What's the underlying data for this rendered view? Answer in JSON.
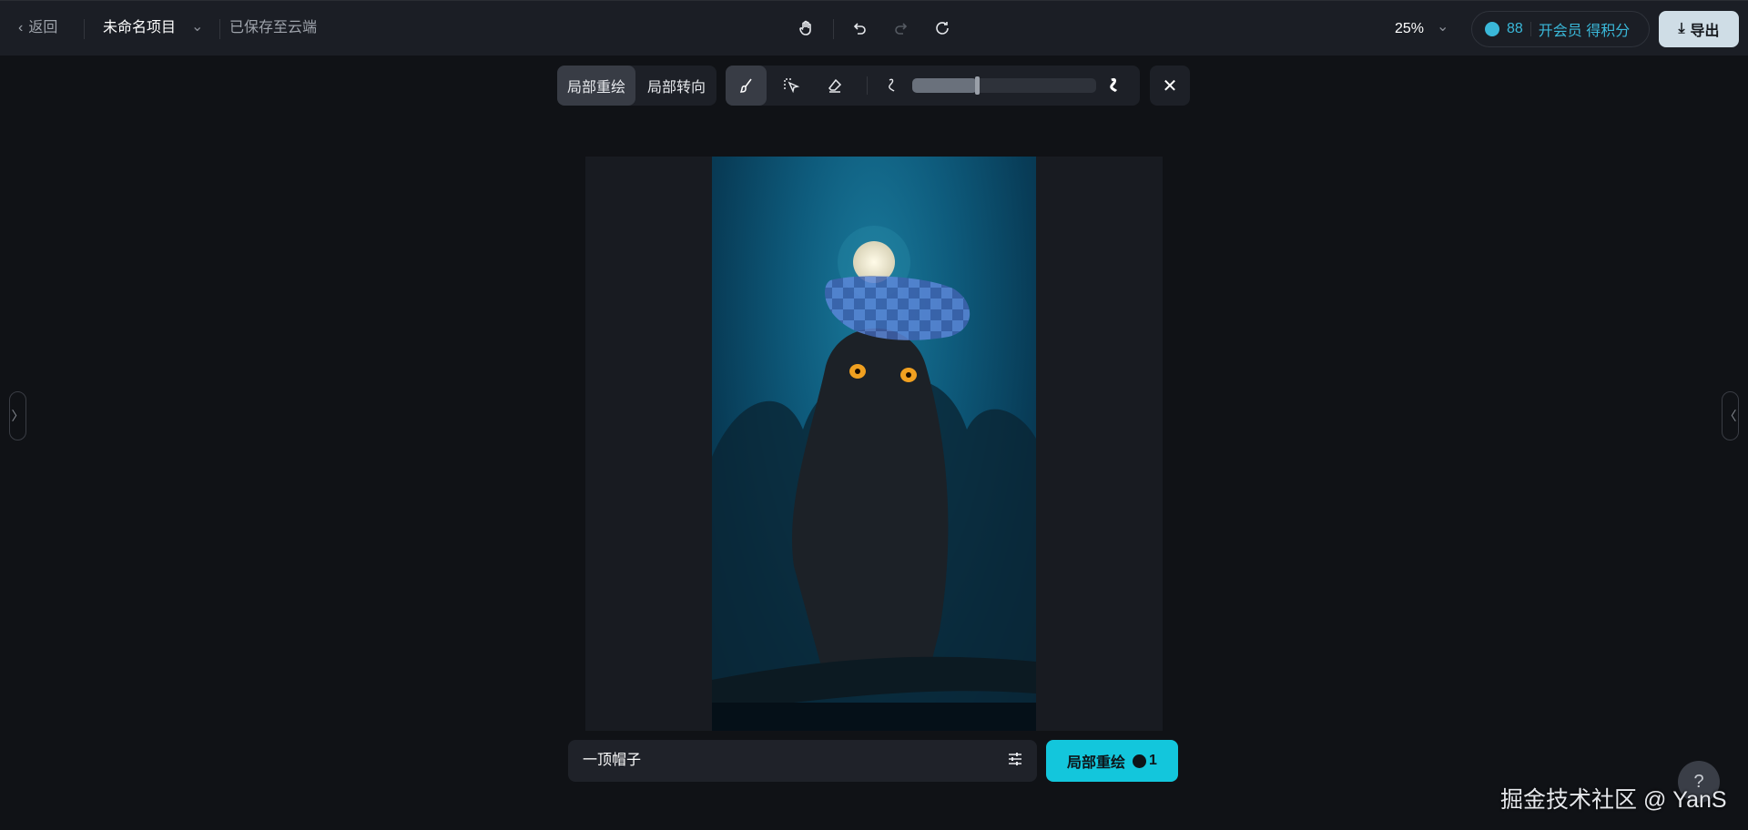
{
  "topbar": {
    "back": "返回",
    "project_title": "未命名项目",
    "save_status": "已保存至云端",
    "zoom": "25%",
    "credits": "88",
    "membership": "开会员 得积分",
    "export": "导出"
  },
  "toolbar": {
    "modes": [
      "局部重绘",
      "局部转向"
    ],
    "active_mode": "局部重绘",
    "brush_size_percent": 35
  },
  "prompt": {
    "value": "一顶帽子",
    "generate_label": "局部重绘",
    "generate_cost": "1"
  },
  "watermark": "掘金技术社区 @ YanS",
  "help": "?",
  "colors": {
    "accent": "#13c6dc",
    "credits": "#3ab8d9"
  }
}
